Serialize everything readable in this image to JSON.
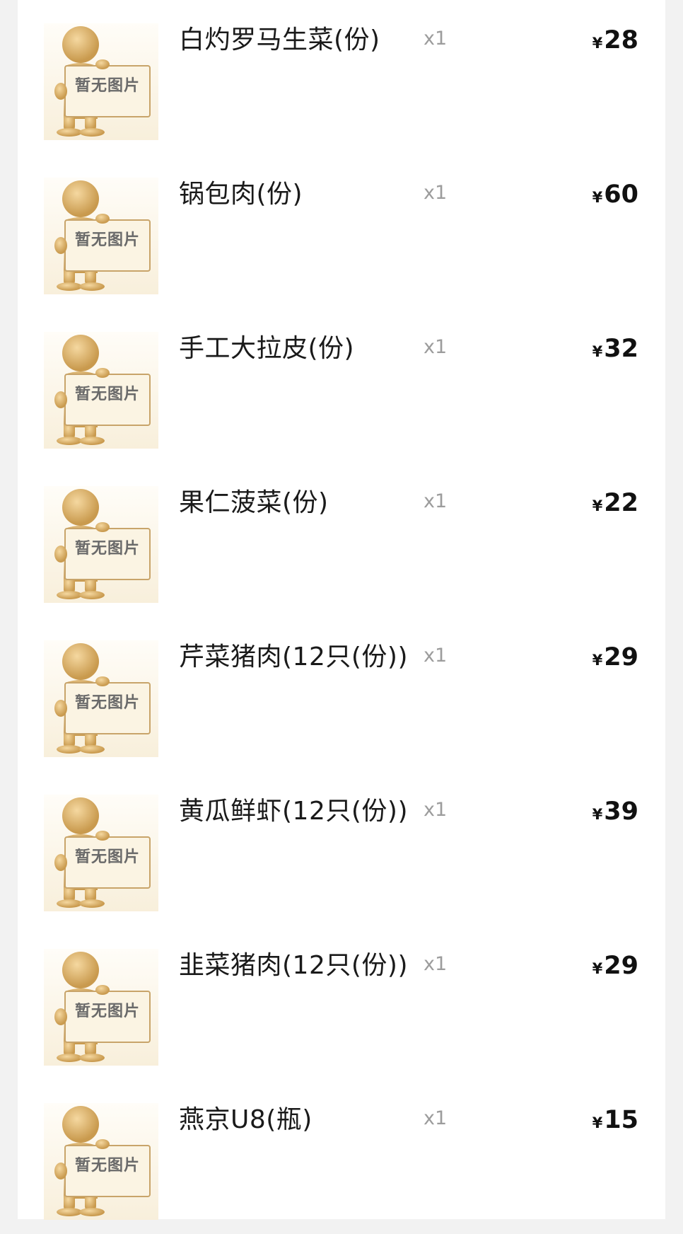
{
  "list": {
    "items": [
      {
        "name": "白灼罗马生菜(份)",
        "qty": "x1",
        "currency": "¥",
        "price": "28",
        "image_text": "暂无图片"
      },
      {
        "name": "锅包肉(份)",
        "qty": "x1",
        "currency": "¥",
        "price": "60",
        "image_text": "暂无图片"
      },
      {
        "name": "手工大拉皮(份)",
        "qty": "x1",
        "currency": "¥",
        "price": "32",
        "image_text": "暂无图片"
      },
      {
        "name": "果仁菠菜(份)",
        "qty": "x1",
        "currency": "¥",
        "price": "22",
        "image_text": "暂无图片"
      },
      {
        "name": "芹菜猪肉(12只(份))",
        "qty": "x1",
        "currency": "¥",
        "price": "29",
        "image_text": "暂无图片"
      },
      {
        "name": "黄瓜鲜虾(12只(份))",
        "qty": "x1",
        "currency": "¥",
        "price": "39",
        "image_text": "暂无图片"
      },
      {
        "name": "韭菜猪肉(12只(份))",
        "qty": "x1",
        "currency": "¥",
        "price": "29",
        "image_text": "暂无图片"
      },
      {
        "name": "燕京U8(瓶)",
        "qty": "x1",
        "currency": "¥",
        "price": "15",
        "image_text": "暂无图片"
      }
    ]
  }
}
